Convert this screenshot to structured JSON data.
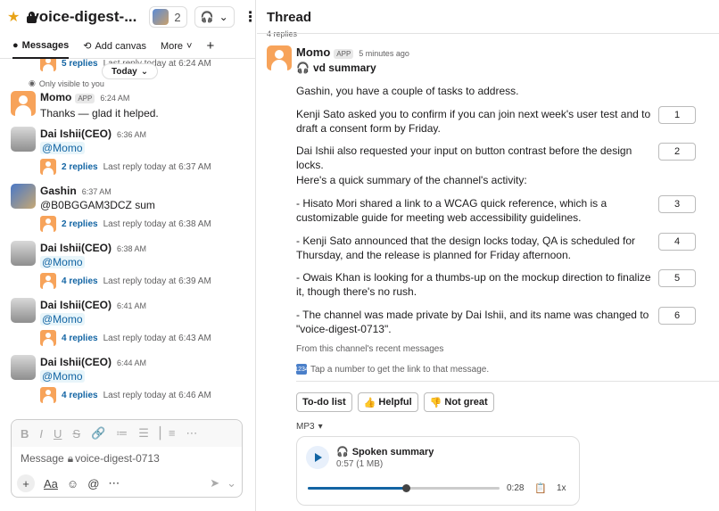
{
  "channel": {
    "name": "voice-digest-...",
    "member_count": "2"
  },
  "tabs": [
    {
      "label": "Messages"
    },
    {
      "label": "Add canvas"
    },
    {
      "label": "More"
    }
  ],
  "messages_pane": {
    "clipped_top": {
      "replies": "5 replies",
      "last": "Last reply today at 6:24 AM"
    },
    "date_pill": "Today",
    "only_visible": "Only visible to you",
    "momo_msg": {
      "name": "Momo",
      "badge": "APP",
      "time": "6:24 AM",
      "text": "Thanks — glad it helped."
    },
    "items": [
      {
        "name": "Dai Ishii(CEO)",
        "time": "6:36 AM",
        "text": "@Momo",
        "replies": "2 replies",
        "last": "Last reply today at 6:37 AM"
      },
      {
        "name": "Gashin",
        "time": "6:37 AM",
        "text": "@B0BGGAM3DCZ sum",
        "replies": "2 replies",
        "last": "Last reply today at 6:38 AM"
      },
      {
        "name": "Dai Ishii(CEO)",
        "time": "6:38 AM",
        "text": "@Momo",
        "replies": "4 replies",
        "last": "Last reply today at 6:39 AM"
      },
      {
        "name": "Dai Ishii(CEO)",
        "time": "6:41 AM",
        "text": "@Momo",
        "replies": "4 replies",
        "last": "Last reply today at 6:43 AM"
      },
      {
        "name": "Dai Ishii(CEO)",
        "time": "6:44 AM",
        "text": "@Momo",
        "replies": "4 replies",
        "last": "Last reply today at 6:46 AM"
      }
    ]
  },
  "composer": {
    "placeholder_prefix": "Message",
    "channel": "voice-digest-0713"
  },
  "thread": {
    "title": "Thread",
    "clipped_replies": "4 replies",
    "author": "Momo",
    "badge": "APP",
    "time": "5 minutes ago",
    "summary_title": "vd summary",
    "intro": "Gashin, you have a couple of tasks to address.",
    "tasks": [
      {
        "text": "Kenji Sato asked you to confirm if you can join next week's user test and to draft a consent form by Friday.",
        "num": "1"
      },
      {
        "text": "Dai Ishii also requested your input on button contrast before the design locks.",
        "num": "2"
      }
    ],
    "summary_intro": "Here's a quick summary of the channel's activity:",
    "points": [
      {
        "text": "- Hisato Mori shared a link to a WCAG quick reference, which is a customizable guide for meeting web accessibility guidelines.",
        "num": "3"
      },
      {
        "text": "- Kenji Sato announced that the design locks today, QA is scheduled for Thursday, and the release is planned for Friday afternoon.",
        "num": "4"
      },
      {
        "text": "- Owais Khan is looking for a thumbs-up on the mockup direction to finalize it, though there's no rush.",
        "num": "5"
      },
      {
        "text": "- The channel was made private by Dai Ishii, and its name was changed to \"voice-digest-0713\".",
        "num": "6"
      }
    ],
    "source_note": "From this channel's recent messages",
    "hint": "Tap a number to get the link to that message.",
    "actions": [
      {
        "label": "To-do list"
      },
      {
        "label": "Helpful",
        "emoji": "👍"
      },
      {
        "label": "Not great",
        "emoji": "👎"
      }
    ],
    "mp3_label": "MP3",
    "player": {
      "title": "Spoken summary",
      "sub": "0:57 (1 MB)",
      "remaining": "0:28",
      "speed": "1x",
      "progress": 0.51
    }
  }
}
